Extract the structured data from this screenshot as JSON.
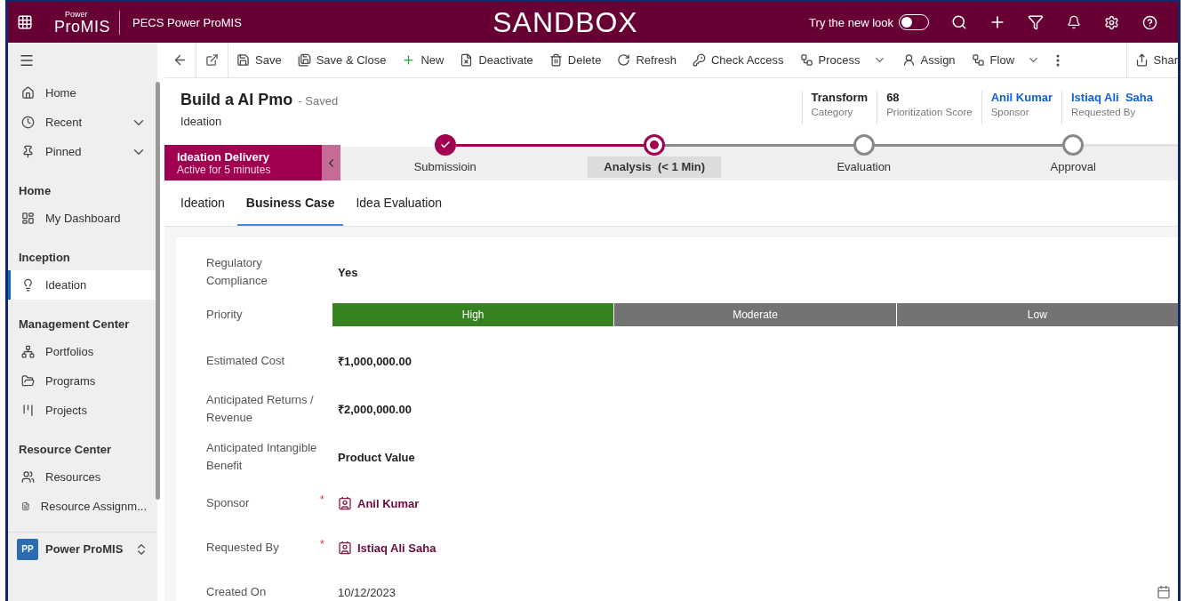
{
  "header": {
    "logo_small": "Power",
    "logo_main": "ProMIS",
    "app_name": "PECS Power ProMIS",
    "environment": "SANDBOX",
    "new_look": {
      "label": "Try the new look",
      "on": false
    }
  },
  "sidebar": {
    "items": [
      {
        "kind": "item",
        "label": "Home",
        "expandable": false,
        "selected": false
      },
      {
        "kind": "item",
        "label": "Recent",
        "expandable": true,
        "selected": false
      },
      {
        "kind": "item",
        "label": "Pinned",
        "expandable": true,
        "selected": false
      },
      {
        "kind": "header",
        "label": "Home"
      },
      {
        "kind": "item",
        "label": "My Dashboard",
        "expandable": false,
        "selected": false
      },
      {
        "kind": "header",
        "label": "Inception"
      },
      {
        "kind": "item",
        "label": "Ideation",
        "expandable": false,
        "selected": true
      },
      {
        "kind": "header",
        "label": "Management Center"
      },
      {
        "kind": "item",
        "label": "Portfolios",
        "expandable": false,
        "selected": false
      },
      {
        "kind": "item",
        "label": "Programs",
        "expandable": false,
        "selected": false
      },
      {
        "kind": "item",
        "label": "Projects",
        "expandable": false,
        "selected": false
      },
      {
        "kind": "header",
        "label": "Resource Center"
      },
      {
        "kind": "item",
        "label": "Resources",
        "expandable": false,
        "selected": false
      },
      {
        "kind": "item",
        "label": "Resource Assignm...",
        "expandable": false,
        "selected": false
      }
    ],
    "area": {
      "initials": "PP",
      "label": "Power ProMIS"
    }
  },
  "commands": [
    {
      "label": "Save",
      "dropdown": false
    },
    {
      "label": "Save & Close",
      "dropdown": false
    },
    {
      "label": "New",
      "dropdown": false
    },
    {
      "label": "Deactivate",
      "dropdown": false
    },
    {
      "label": "Delete",
      "dropdown": false
    },
    {
      "label": "Refresh",
      "dropdown": false
    },
    {
      "label": "Check Access",
      "dropdown": false
    },
    {
      "label": "Process",
      "dropdown": true
    },
    {
      "label": "Assign",
      "dropdown": false
    },
    {
      "label": "Flow",
      "dropdown": true
    }
  ],
  "share": "Shar",
  "record": {
    "title": "Build a AI Pmo",
    "status": "- Saved",
    "entity": "Ideation"
  },
  "header_fields": [
    {
      "value": "Transform",
      "label": "Category",
      "kind": "text"
    },
    {
      "value": "68",
      "label": "Prioritization Score",
      "kind": "text"
    },
    {
      "value": "Anil Kumar",
      "label": "Sponsor",
      "kind": "link"
    },
    {
      "value": "Istiaq Ali  Saha",
      "label": "Requested By",
      "kind": "link"
    }
  ],
  "process": {
    "name": "Ideation Delivery",
    "duration": "Active for 5 minutes",
    "stages": [
      {
        "label": "Submissioin",
        "completed": true,
        "selected": false
      },
      {
        "label": "Analysis  (< 1 Min)",
        "completed": false,
        "selected": true
      },
      {
        "label": "Evaluation",
        "completed": false,
        "selected": false
      },
      {
        "label": "Approval",
        "completed": false,
        "selected": false
      }
    ]
  },
  "tabs": [
    {
      "label": "Ideation",
      "selected": false
    },
    {
      "label": "Business Case",
      "selected": true
    },
    {
      "label": "Idea Evaluation",
      "selected": false
    }
  ],
  "fields": [
    {
      "kind": "text",
      "label": "Regulatory Compliance",
      "value": "Yes"
    },
    {
      "kind": "priority",
      "label": "Priority",
      "options": [
        {
          "label": "High",
          "selected": true
        },
        {
          "label": "Moderate",
          "selected": false
        },
        {
          "label": "Low",
          "selected": false
        }
      ]
    },
    {
      "kind": "text",
      "label": "Estimated Cost",
      "value": "₹1,000,000.00"
    },
    {
      "kind": "text",
      "label": "Anticipated Returns / Revenue",
      "value": "₹2,000,000.00"
    },
    {
      "kind": "text",
      "label": "Anticipated Intangible Benefit",
      "value": "Product Value"
    },
    {
      "kind": "lookup",
      "label": "Sponsor",
      "value": "Anil Kumar",
      "required_mark": "*"
    },
    {
      "kind": "lookup",
      "label": "Requested By",
      "value": "Istiaq Ali Saha",
      "required_mark": "*"
    },
    {
      "kind": "date",
      "label": "Created On",
      "value": "10/12/2023"
    }
  ]
}
